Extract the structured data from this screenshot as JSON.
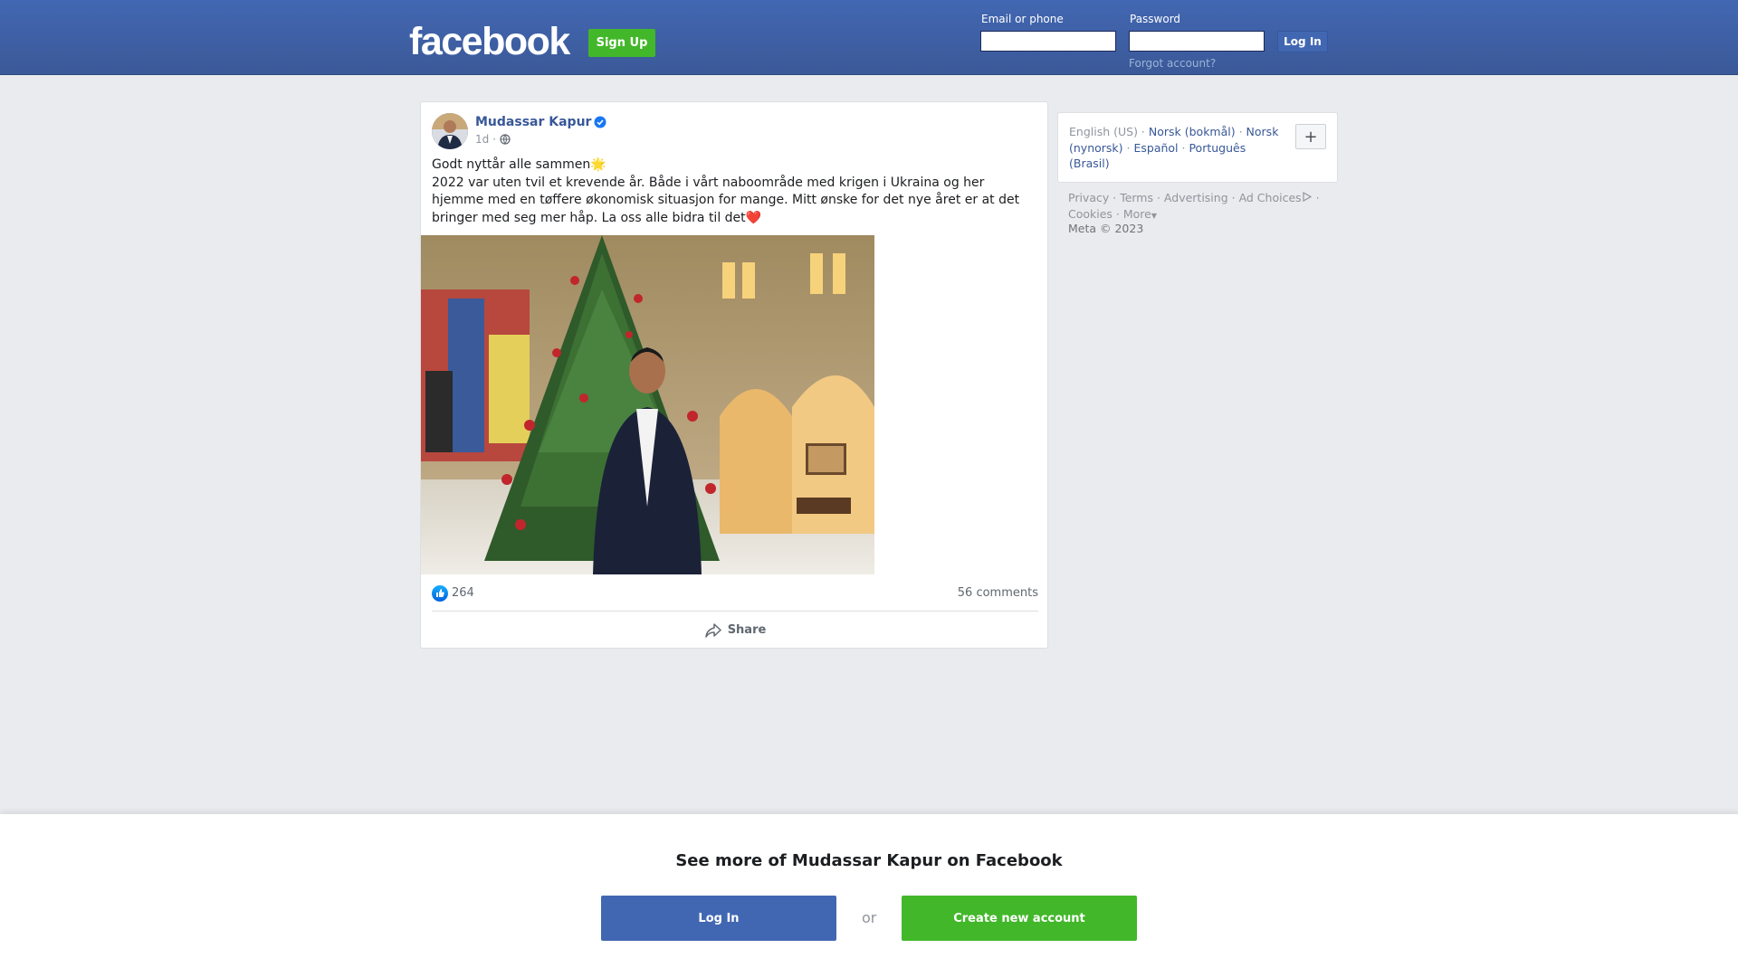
{
  "header": {
    "logo": "facebook",
    "signup_label": "Sign Up",
    "email_label": "Email or phone",
    "password_label": "Password",
    "login_label": "Log In",
    "forgot_label": "Forgot account?"
  },
  "post": {
    "author": "Mudassar Kapur",
    "time": "1d",
    "audience_icon": "globe-icon",
    "text_line1": "Godt nyttår alle sammen🌟",
    "text_body": "2022 var uten tvil et krevende år. Både i vårt naboområde med krigen i Ukraina og her hjemme med en tøffere økonomisk situasjon for mange. Mitt ønske for det nye året er at det bringer med seg mer håp. La oss alle bidra til det❤️",
    "likes": "264",
    "comments": "56 comments",
    "share_label": "Share"
  },
  "sidebar": {
    "lang_current": "English (US)",
    "lang_1": "Norsk (bokmål)",
    "lang_2": "Norsk (nynorsk)",
    "lang_3": "Español",
    "lang_4": "Português (Brasil)",
    "plus_label": "+",
    "footer_privacy": "Privacy",
    "footer_terms": "Terms",
    "footer_advertising": "Advertising",
    "footer_adchoices": "Ad Choices",
    "footer_cookies": "Cookies",
    "footer_more": "More",
    "copyright": "Meta © 2023"
  },
  "bottom": {
    "title": "See more of Mudassar Kapur on Facebook",
    "login_label": "Log In",
    "or_label": "or",
    "create_label": "Create new account"
  },
  "colors": {
    "brand": "#4267b2",
    "green": "#42b72a",
    "link": "#385898"
  }
}
